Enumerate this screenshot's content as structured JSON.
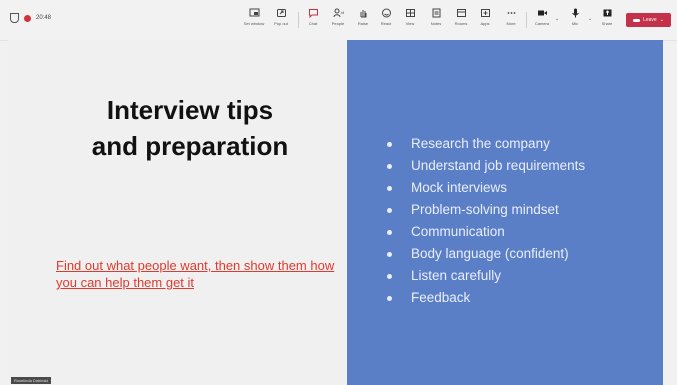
{
  "toolbar": {
    "timer": "20:48",
    "buttons": [
      {
        "label": "Set window",
        "icon": "window-icon"
      },
      {
        "label": "Pop out",
        "icon": "popout-icon"
      },
      {
        "label": "Chat",
        "icon": "chat-icon"
      },
      {
        "label": "People",
        "icon": "people-icon"
      },
      {
        "label": "Raise",
        "icon": "raise-hand-icon"
      },
      {
        "label": "React",
        "icon": "react-icon"
      },
      {
        "label": "View",
        "icon": "view-icon"
      },
      {
        "label": "Notes",
        "icon": "notes-icon"
      },
      {
        "label": "Rooms",
        "icon": "rooms-icon"
      },
      {
        "label": "Apps",
        "icon": "apps-icon"
      },
      {
        "label": "More",
        "icon": "more-icon"
      },
      {
        "label": "Camera",
        "icon": "camera-icon"
      },
      {
        "label": "Mic",
        "icon": "mic-icon"
      },
      {
        "label": "Share",
        "icon": "share-icon"
      }
    ],
    "leave_label": "Leave",
    "leave_color": "#c4314b"
  },
  "slide": {
    "title_line1": "Interview tips",
    "title_line2": "and preparation",
    "quote": "Find out what people want, then show them how you can help them get it",
    "bullets": [
      "Research the company",
      "Understand job requirements",
      "Mock interviews",
      "Problem-solving mindset",
      "Communication",
      "Body language (confident)",
      "Listen carefully",
      "Feedback"
    ],
    "panel_color": "#5b7fc7",
    "quote_color": "#e03a2e"
  },
  "participant": {
    "name": "Roselinda Dubinski"
  }
}
